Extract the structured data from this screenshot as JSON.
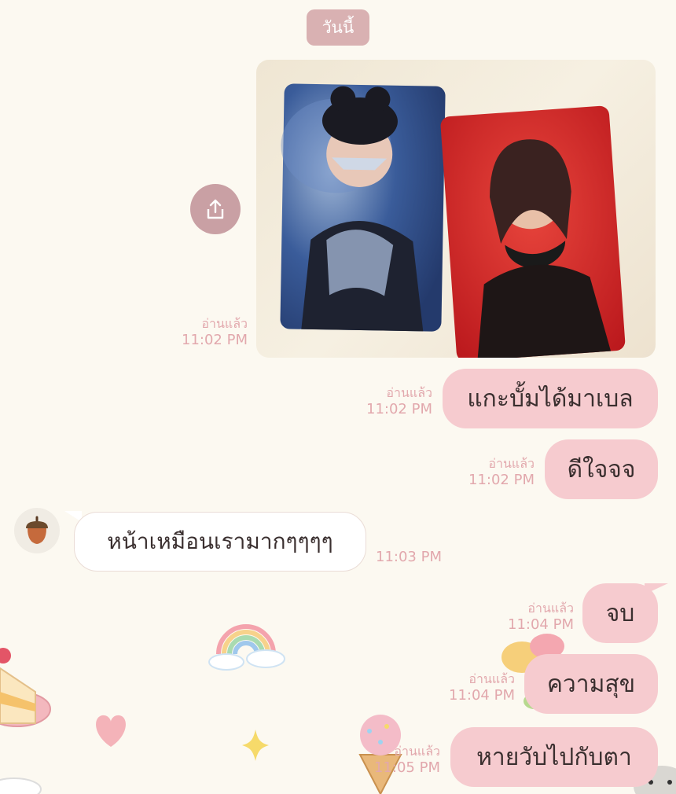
{
  "date_chip": "วันนี้",
  "colors": {
    "background": "#fcf9f1",
    "outgoing_bubble": "#f6cbcf",
    "incoming_bubble": "#ffffff",
    "meta_text": "#e2a8ad",
    "date_chip": "#d9b1b2"
  },
  "icons": {
    "share": "share-icon",
    "avatar": "acorn-icon"
  },
  "messages": [
    {
      "id": "m1",
      "type": "image",
      "direction": "out",
      "read": "อ่านแล้ว",
      "time": "11:02 PM",
      "alt": "photocards"
    },
    {
      "id": "m2",
      "type": "text",
      "direction": "out",
      "text": "แกะบั้มได้มาเบล",
      "read": "อ่านแล้ว",
      "time": "11:02 PM"
    },
    {
      "id": "m3",
      "type": "text",
      "direction": "out",
      "text": "ดีใจจจ",
      "read": "อ่านแล้ว",
      "time": "11:02 PM"
    },
    {
      "id": "m4",
      "type": "text",
      "direction": "in",
      "text": "หน้าเหมือนเรามากๆๆๆๆ",
      "time": "11:03 PM"
    },
    {
      "id": "m5",
      "type": "text",
      "direction": "out",
      "text": "จบ",
      "read": "อ่านแล้ว",
      "time": "11:04 PM"
    },
    {
      "id": "m6",
      "type": "text",
      "direction": "out",
      "text": "ความสุข",
      "read": "อ่านแล้ว",
      "time": "11:04 PM"
    },
    {
      "id": "m7",
      "type": "text",
      "direction": "out",
      "text": "หายวับไปกับตา",
      "read": "อ่านแล้ว",
      "time": "11:05 PM"
    }
  ]
}
